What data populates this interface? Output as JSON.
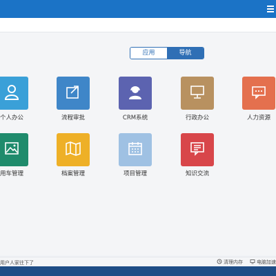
{
  "header": {
    "accent_color": "#1b73c6",
    "menu_icon": "hamburger-menu-icon"
  },
  "view_toggle": {
    "tabs": [
      {
        "label": "应用",
        "active": false
      },
      {
        "label": "导航",
        "active": true
      }
    ]
  },
  "apps": [
    {
      "label": "个人办公",
      "icon": "person-icon",
      "color": "#3aa0d8"
    },
    {
      "label": "流程审批",
      "icon": "share-arrow-icon",
      "color": "#3f86c8"
    },
    {
      "label": "CRM系统",
      "icon": "support-agent-icon",
      "color": "#5c63b0"
    },
    {
      "label": "行政办公",
      "icon": "monitor-icon",
      "color": "#b89160"
    },
    {
      "label": "人力资源",
      "icon": "chat-bubble-icon",
      "color": "#e4704e"
    },
    {
      "label": "用车管理",
      "icon": "image-icon",
      "color": "#1f8b6c"
    },
    {
      "label": "档案管理",
      "icon": "map-folded-icon",
      "color": "#eeb027"
    },
    {
      "label": "项目管理",
      "icon": "calendar-icon",
      "color": "#9fc1e3"
    },
    {
      "label": "知识交流",
      "icon": "message-lines-icon",
      "color": "#d8464a"
    }
  ],
  "footer": {
    "left_text": "用户人家往下了",
    "right_items": [
      {
        "label": "清理内存",
        "icon": "clean-icon"
      },
      {
        "label": "电脑加速",
        "icon": "speed-icon"
      }
    ]
  }
}
